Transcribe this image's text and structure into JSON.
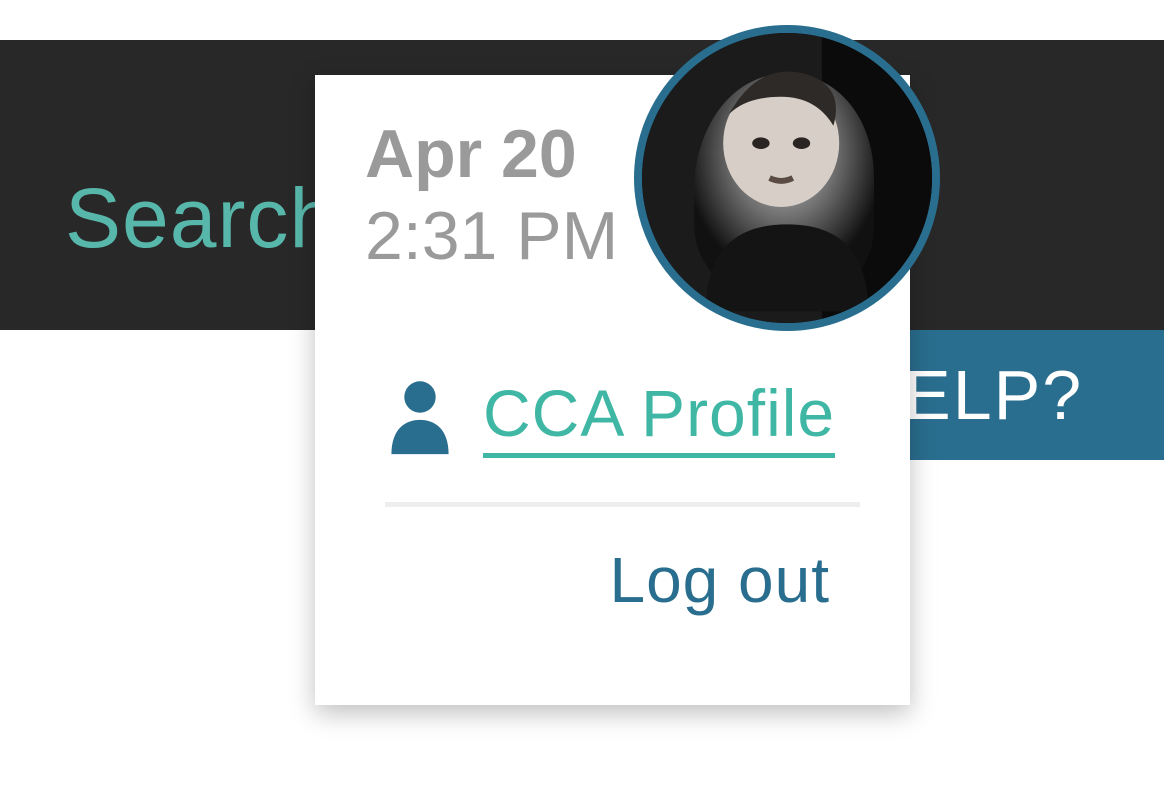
{
  "header": {
    "search_label": "Search"
  },
  "help": {
    "label_fragment": "ELP?"
  },
  "user_menu": {
    "date": "Apr 20",
    "time": "2:31 PM",
    "profile_link": "CCA Profile",
    "logout_label": "Log out"
  }
}
